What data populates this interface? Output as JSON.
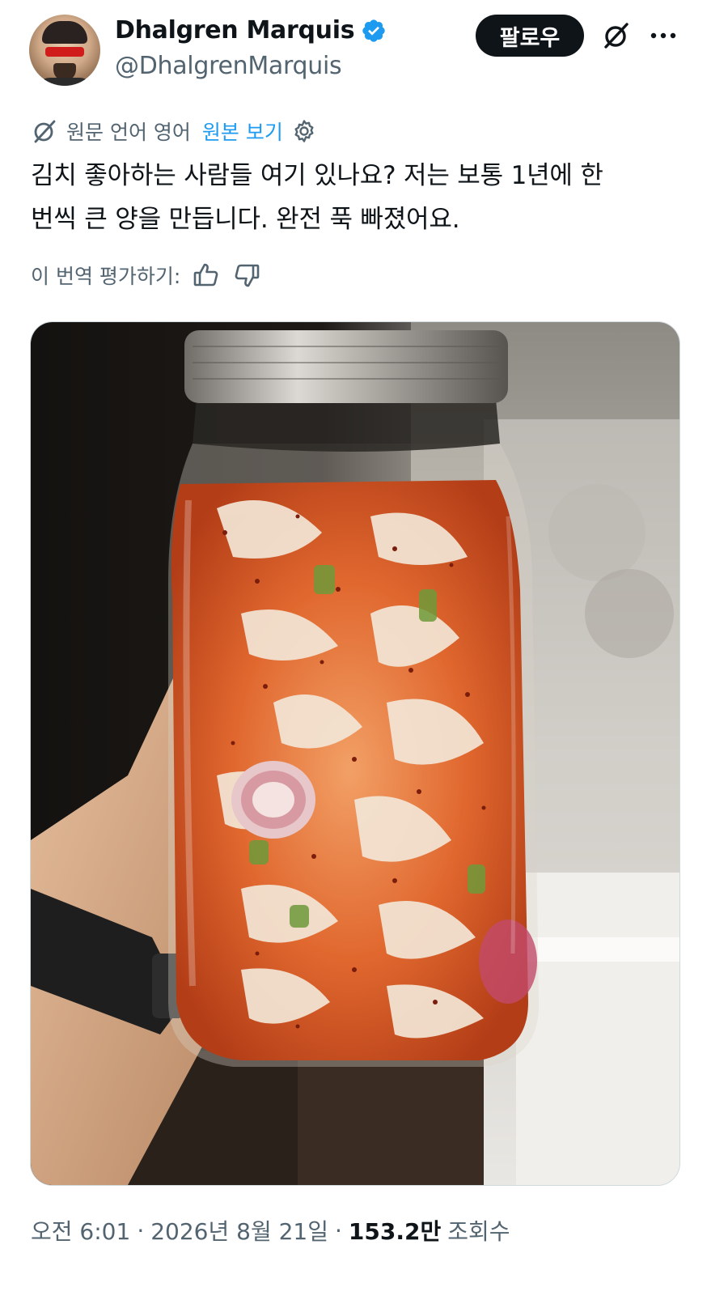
{
  "author": {
    "display_name": "Dhalgren Marquis",
    "handle": "@DhalgrenMarquis",
    "verified_icon": "verified-badge-icon",
    "verified_color": "#1d9bf0"
  },
  "header": {
    "follow_label": "팔로우",
    "grok_icon": "grok-icon",
    "more_icon": "more-icon"
  },
  "translation": {
    "source_text": "원문 언어 영어",
    "show_original_label": "원본 보기",
    "translate_icon": "translate-icon",
    "settings_icon": "gear-icon",
    "rate_label": "이 번역 평가하기:",
    "thumbs_up_icon": "thumbs-up-icon",
    "thumbs_down_icon": "thumbs-down-icon"
  },
  "tweet": {
    "text_line1": "김치 좋아하는 사람들 여기 있나요? 저는 보통 1년에 한",
    "text_line2": "번씩 큰 양을 만듭니다. 완전 푹 빠졌어요.",
    "media_description_icon": "kimchi-jar-photo"
  },
  "meta": {
    "time": "오전 6:01",
    "separator": "·",
    "date": "2026년 8월 21일",
    "views_count": "153.2만",
    "views_label": "조회수"
  },
  "colors": {
    "text_primary": "#0f1419",
    "text_secondary": "#536471",
    "link": "#1d9bf0",
    "button_bg": "#0f1419",
    "button_text": "#ffffff"
  }
}
